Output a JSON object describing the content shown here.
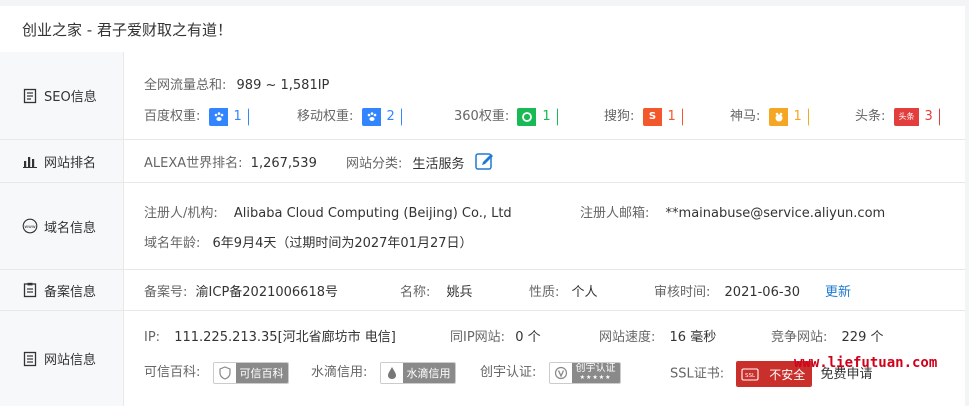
{
  "site_title": "创业之家 - 君子爱财取之有道！",
  "seo": {
    "label": "SEO信息",
    "traffic_label": "全网流量总和:",
    "traffic_value": "989 ~ 1,581IP",
    "weights": [
      {
        "label": "百度权重:",
        "value": "1",
        "color": "#3385ff",
        "icon": "paw-icon"
      },
      {
        "label": "移动权重:",
        "value": "2",
        "color": "#3385ff",
        "icon": "paw-icon"
      },
      {
        "label": "360权重:",
        "value": "1",
        "color": "#19b955",
        "icon": "360-icon"
      },
      {
        "label": "搜狗:",
        "value": "1",
        "color": "#f3582c",
        "icon": "sogou-icon"
      },
      {
        "label": "神马:",
        "value": "1",
        "color": "#f5a623",
        "icon": "shenma-icon"
      },
      {
        "label": "头条:",
        "value": "3",
        "color": "#e33e3e",
        "icon": "toutiao-icon",
        "icon_text": "头条"
      }
    ]
  },
  "rank": {
    "label": "网站排名",
    "alexa_label": "ALEXA世界排名:",
    "alexa_value": "1,267,539",
    "category_label": "网站分类:",
    "category_value": "生活服务"
  },
  "domain": {
    "label": "域名信息",
    "registrant_label": "注册人/机构:",
    "registrant_value": "Alibaba Cloud Computing (Beijing) Co., Ltd",
    "email_label": "注册人邮箱:",
    "email_value": "**mainabuse@service.aliyun.com",
    "age_label": "域名年龄:",
    "age_value": "6年9月4天（过期时间为2027年01月27日）"
  },
  "icp": {
    "label": "备案信息",
    "number_label": "备案号:",
    "number_value": "渝ICP备2021006618号",
    "name_label": "名称:",
    "name_value": "姚兵",
    "type_label": "性质:",
    "type_value": "个人",
    "audit_label": "审核时间:",
    "audit_value": "2021-06-30",
    "update_label": "更新"
  },
  "site": {
    "label": "网站信息",
    "ip_label": "IP:",
    "ip_value": "111.225.213.35[河北省廊坊市 电信]",
    "same_ip_label": "同IP网站:",
    "same_ip_value": "0 个",
    "speed_label": "网站速度:",
    "speed_value": "16 毫秒",
    "competitor_label": "竞争网站:",
    "competitor_value": "229 个",
    "kexin_label": "可信百科:",
    "kexin_btn": "可信百科",
    "shuidi_label": "水滴信用:",
    "shuidi_btn": "水滴信用",
    "chuangyu_label": "创宇认证:",
    "chuangyu_btn": "创宇认证",
    "chuangyu_stars": "★★★★★",
    "ssl_label": "SSL证书:",
    "ssl_btn": "不安全",
    "ssl_icon_text": "SSL",
    "ssl_apply": "免费申请"
  },
  "watermark": "www.liefutuan.com"
}
